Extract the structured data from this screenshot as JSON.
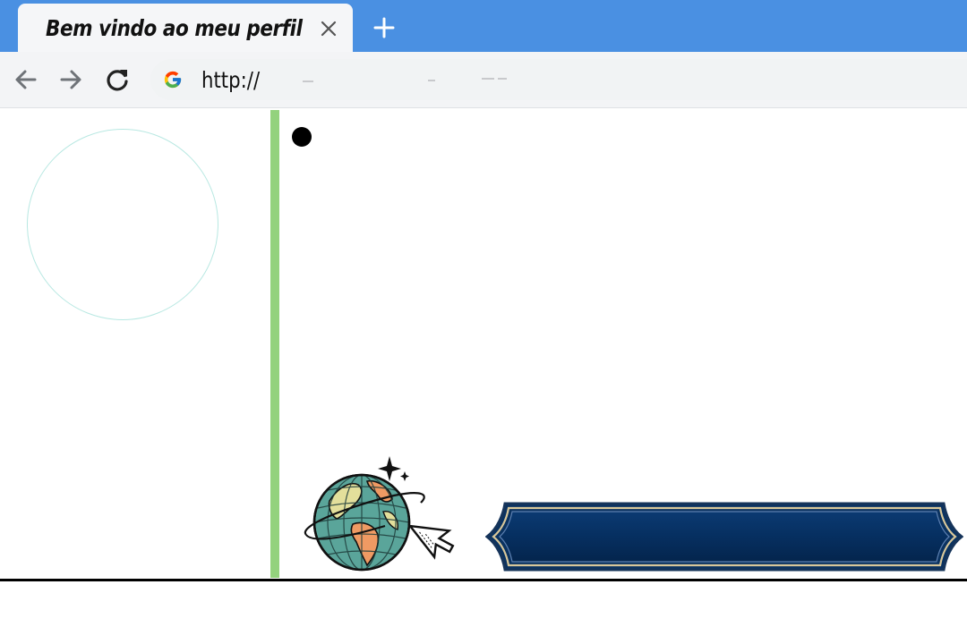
{
  "browser": {
    "tab": {
      "title": "Bem vindo ao meu perfil",
      "close_icon": "close-icon"
    },
    "new_tab_icon": "plus-icon",
    "nav": {
      "back_icon": "arrow-left-icon",
      "forward_icon": "arrow-right-icon",
      "reload_icon": "reload-icon"
    },
    "address_bar": {
      "engine_icon": "google-g-icon",
      "url": "http://"
    }
  },
  "page": {
    "profile_photo": "empty-circle",
    "divider_color": "#93d27d",
    "bullet_icon": "bullet-dot",
    "decoration": "globe-with-cursor-icon",
    "banner_button": {
      "label": "",
      "color": "#062f60"
    }
  },
  "colors": {
    "tabbar": "#4a90e2",
    "toolbar": "#f3f4f6",
    "accent_gold": "#d8c79a"
  }
}
